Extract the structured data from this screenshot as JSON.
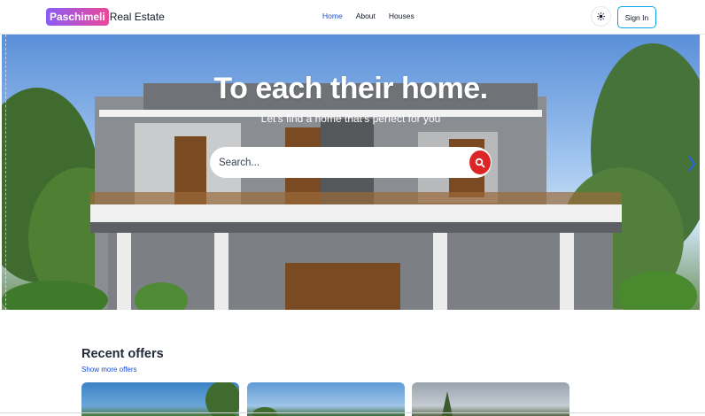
{
  "brand": {
    "highlight": "Paschimeli",
    "rest": "Real Estate"
  },
  "nav": {
    "items": [
      {
        "label": "Home",
        "active": true
      },
      {
        "label": "About",
        "active": false
      },
      {
        "label": "Houses",
        "active": false
      }
    ]
  },
  "header": {
    "theme_icon": "sun-icon",
    "signin_label": "Sign In"
  },
  "hero": {
    "title": "To each their home.",
    "subtitle": "Let's find a home that's perfect for you",
    "search_placeholder": "Search...",
    "search_icon": "search-icon",
    "next_icon": "chevron-right-icon"
  },
  "offers": {
    "title": "Recent offers",
    "more_link": "Show more offers"
  },
  "colors": {
    "accent": "#1d4ed8",
    "search_button": "#dc2626",
    "signin_border": "#0ea5e9",
    "brand_gradient_start": "#8b5cf6",
    "brand_gradient_end": "#ec4899"
  }
}
